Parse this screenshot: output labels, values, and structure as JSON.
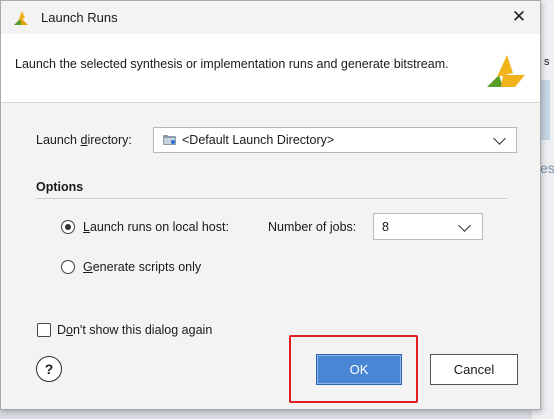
{
  "background": {
    "fragment_top": "s",
    "fragment_mid": "es"
  },
  "dialog": {
    "title": "Launch Runs",
    "close_glyph": "✕",
    "description": "Launch the selected synthesis or implementation runs and generate bitstream."
  },
  "launch_directory": {
    "label_before": "Launch ",
    "label_mnemonic": "d",
    "label_after": "irectory:",
    "value": "<Default Launch Directory>"
  },
  "options": {
    "title": "Options",
    "launch_local": {
      "mnemonic": "L",
      "label_rest": "aunch runs on local host:",
      "selected": true
    },
    "jobs": {
      "label_before": "Number of ",
      "label_mnemonic": "j",
      "label_after": "obs:",
      "value": "8"
    },
    "generate_scripts": {
      "mnemonic": "G",
      "label_rest": "enerate scripts only",
      "selected": false
    }
  },
  "dont_show": {
    "label_before": "D",
    "label_mnemonic": "o",
    "label_after": "n't show this dialog again",
    "checked": false
  },
  "buttons": {
    "help": "?",
    "ok": "OK",
    "cancel": "Cancel"
  },
  "colors": {
    "accent": "#4a86d6",
    "highlight": "#e02020",
    "logo_yellow": "#f2b21a",
    "logo_green": "#5a9e2a"
  }
}
